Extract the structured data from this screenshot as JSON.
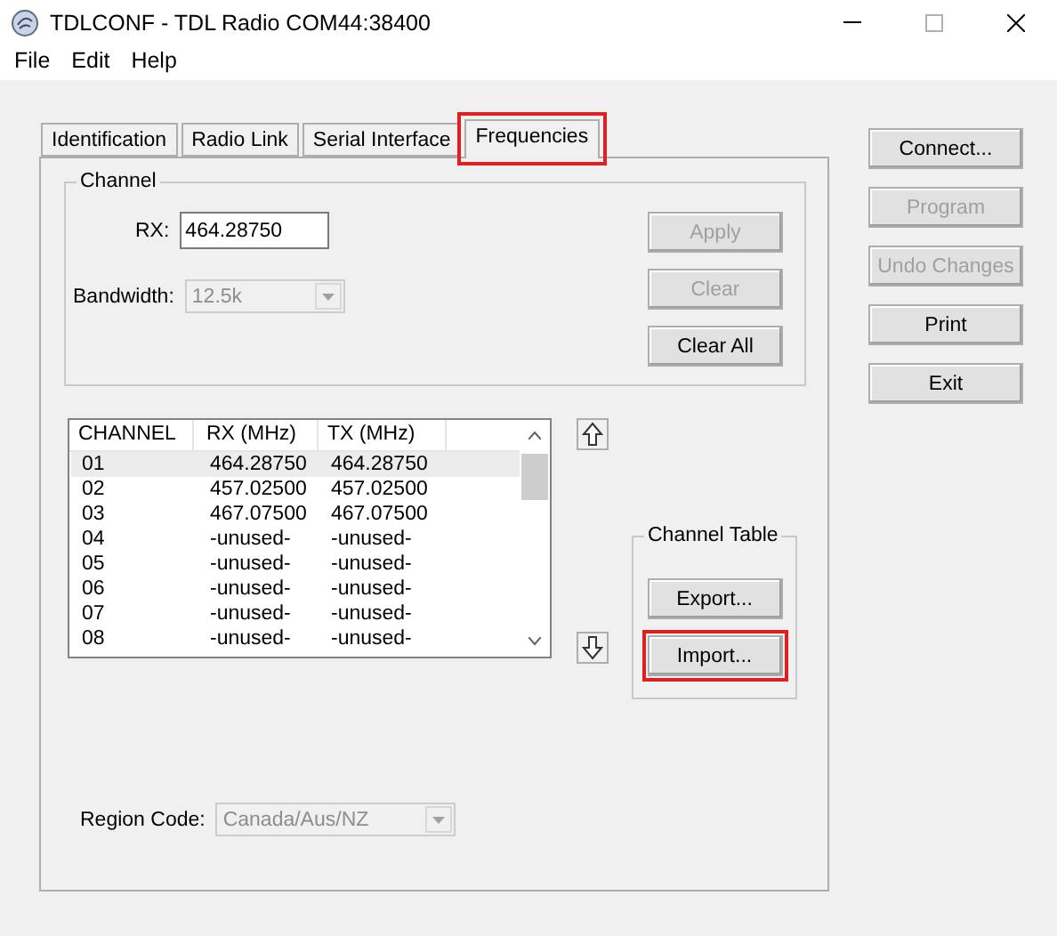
{
  "window": {
    "title": "TDLCONF - TDL Radio COM44:38400"
  },
  "menu": [
    "File",
    "Edit",
    "Help"
  ],
  "tabs": [
    {
      "label": "Identification",
      "selected": false,
      "highlighted": false
    },
    {
      "label": "Radio Link",
      "selected": false,
      "highlighted": false
    },
    {
      "label": "Serial Interface",
      "selected": false,
      "highlighted": false
    },
    {
      "label": "Frequencies",
      "selected": true,
      "highlighted": true
    }
  ],
  "channel": {
    "group_label": "Channel",
    "rx_label": "RX:",
    "rx_value": "464.28750",
    "bandwidth_label": "Bandwidth:",
    "bandwidth_value": "12.5k",
    "bandwidth_disabled": true
  },
  "channel_buttons": [
    {
      "label": "Apply",
      "disabled": true
    },
    {
      "label": "Clear",
      "disabled": true
    },
    {
      "label": "Clear All",
      "disabled": false
    }
  ],
  "table": {
    "columns": [
      "CHANNEL",
      "RX (MHz)",
      "TX (MHz)"
    ],
    "rows": [
      {
        "cells": [
          "01",
          "464.28750",
          "464.28750"
        ],
        "selected": true
      },
      {
        "cells": [
          "02",
          "457.02500",
          "457.02500"
        ],
        "selected": false
      },
      {
        "cells": [
          "03",
          "467.07500",
          "467.07500"
        ],
        "selected": false
      },
      {
        "cells": [
          "04",
          "-unused-",
          "-unused-"
        ],
        "selected": false
      },
      {
        "cells": [
          "05",
          "-unused-",
          "-unused-"
        ],
        "selected": false
      },
      {
        "cells": [
          "06",
          "-unused-",
          "-unused-"
        ],
        "selected": false
      },
      {
        "cells": [
          "07",
          "-unused-",
          "-unused-"
        ],
        "selected": false
      },
      {
        "cells": [
          "08",
          "-unused-",
          "-unused-"
        ],
        "selected": false
      }
    ]
  },
  "channel_table": {
    "group_label": "Channel Table",
    "buttons": [
      {
        "label": "Export...",
        "highlighted": false
      },
      {
        "label": "Import...",
        "highlighted": true
      }
    ]
  },
  "region": {
    "label": "Region Code:",
    "value": "Canada/Aus/NZ",
    "disabled": true
  },
  "side_buttons": [
    {
      "label": "Connect...",
      "disabled": false
    },
    {
      "label": "Program",
      "disabled": true
    },
    {
      "label": "Undo Changes",
      "disabled": true
    },
    {
      "label": "Print",
      "disabled": false
    },
    {
      "label": "Exit",
      "disabled": false
    }
  ]
}
